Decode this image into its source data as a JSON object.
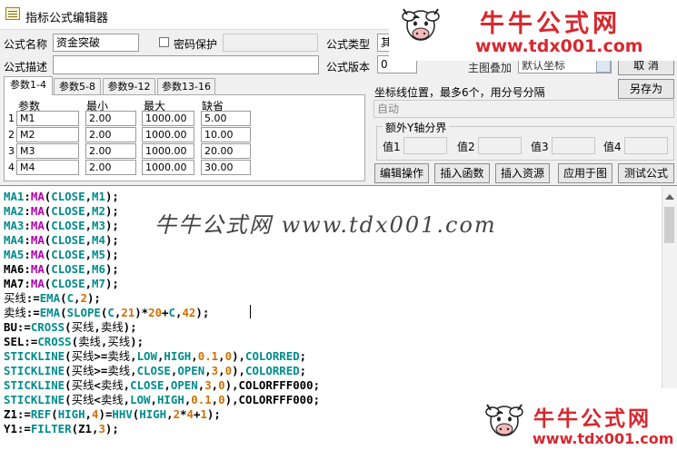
{
  "window": {
    "title": "指标公式编辑器"
  },
  "logo_top": {
    "title": "牛牛公式网",
    "url": "www.tdx001.com"
  },
  "logo_bottom": {
    "title": "牛牛公式网",
    "url": "www.tdx001.com"
  },
  "form": {
    "name_label": "公式名称",
    "name_value": "资金突破",
    "password_label": "密码保护",
    "type_label": "公式类型",
    "type_value": "其他",
    "desc_label": "公式描述",
    "desc_value": "",
    "version_label": "公式版本",
    "version_value": "0",
    "display_partial": "主图叠加",
    "axis_partial": "默认坐标",
    "cancel_partial": "取 消",
    "save_as_label": "另存为"
  },
  "tabs": [
    {
      "label": "参数1-4"
    },
    {
      "label": "参数5-8"
    },
    {
      "label": "参数9-12"
    },
    {
      "label": "参数13-16"
    }
  ],
  "params": {
    "headers": {
      "name": "参数",
      "min": "最小",
      "max": "最大",
      "default": "缺省"
    },
    "rows": [
      {
        "num": "1",
        "name": "M1",
        "min": "2.00",
        "max": "1000.00",
        "default": "5.00"
      },
      {
        "num": "2",
        "name": "M2",
        "min": "2.00",
        "max": "1000.00",
        "default": "10.00"
      },
      {
        "num": "3",
        "name": "M3",
        "min": "2.00",
        "max": "1000.00",
        "default": "20.00"
      },
      {
        "num": "4",
        "name": "M4",
        "min": "2.00",
        "max": "1000.00",
        "default": "30.00"
      }
    ]
  },
  "axis": {
    "label": "坐标线位置，最多6个，用分号分隔",
    "value": "自动"
  },
  "extra_y": {
    "title": "额外Y轴分界",
    "values": [
      {
        "label": "值1",
        "value": ""
      },
      {
        "label": "值2",
        "value": ""
      },
      {
        "label": "值3",
        "value": ""
      },
      {
        "label": "值4",
        "value": ""
      }
    ]
  },
  "buttons": {
    "edit": "编辑操作",
    "insert_func": "插入函数",
    "insert_res": "插入资源",
    "apply": "应用于图",
    "test": "测试公式"
  },
  "editor": {
    "watermark": "牛牛公式网 www.tdx001.com",
    "lines": [
      [
        [
          "kw",
          "MA1"
        ],
        [
          "op",
          ":"
        ],
        [
          "fn",
          "MA"
        ],
        [
          "op",
          "("
        ],
        [
          "kw",
          "CLOSE"
        ],
        [
          "op",
          ","
        ],
        [
          "kw",
          "M1"
        ],
        [
          "op",
          ");"
        ]
      ],
      [
        [
          "kw",
          "MA2"
        ],
        [
          "op",
          ":"
        ],
        [
          "fn",
          "MA"
        ],
        [
          "op",
          "("
        ],
        [
          "kw",
          "CLOSE"
        ],
        [
          "op",
          ","
        ],
        [
          "kw",
          "M2"
        ],
        [
          "op",
          ");"
        ]
      ],
      [
        [
          "kw",
          "MA3"
        ],
        [
          "op",
          ":"
        ],
        [
          "fn",
          "MA"
        ],
        [
          "op",
          "("
        ],
        [
          "kw",
          "CLOSE"
        ],
        [
          "op",
          ","
        ],
        [
          "kw",
          "M3"
        ],
        [
          "op",
          ");"
        ]
      ],
      [
        [
          "kw",
          "MA4"
        ],
        [
          "op",
          ":"
        ],
        [
          "fn",
          "MA"
        ],
        [
          "op",
          "("
        ],
        [
          "kw",
          "CLOSE"
        ],
        [
          "op",
          ","
        ],
        [
          "kw",
          "M4"
        ],
        [
          "op",
          ");"
        ]
      ],
      [
        [
          "kw",
          "MA5"
        ],
        [
          "op",
          ":"
        ],
        [
          "fn",
          "MA"
        ],
        [
          "op",
          "("
        ],
        [
          "kw",
          "CLOSE"
        ],
        [
          "op",
          ","
        ],
        [
          "kw",
          "M5"
        ],
        [
          "op",
          ");"
        ]
      ],
      [
        [
          "op",
          "MA6"
        ],
        [
          "op",
          ":"
        ],
        [
          "fn",
          "MA"
        ],
        [
          "op",
          "("
        ],
        [
          "kw",
          "CLOSE"
        ],
        [
          "op",
          ","
        ],
        [
          "kw",
          "M6"
        ],
        [
          "op",
          ");"
        ]
      ],
      [
        [
          "op",
          "MA7"
        ],
        [
          "op",
          ":"
        ],
        [
          "fn",
          "MA"
        ],
        [
          "op",
          "("
        ],
        [
          "kw",
          "CLOSE"
        ],
        [
          "op",
          ","
        ],
        [
          "kw",
          "M7"
        ],
        [
          "op",
          ");"
        ]
      ],
      [
        [
          "tx",
          "买线"
        ],
        [
          "op",
          ":="
        ],
        [
          "kw",
          "EMA"
        ],
        [
          "op",
          "("
        ],
        [
          "kw",
          "C"
        ],
        [
          "op",
          ","
        ],
        [
          "num",
          "2"
        ],
        [
          "op",
          ");"
        ]
      ],
      [
        [
          "tx",
          "卖线"
        ],
        [
          "op",
          ":="
        ],
        [
          "kw",
          "EMA"
        ],
        [
          "op",
          "("
        ],
        [
          "kw",
          "SLOPE"
        ],
        [
          "op",
          "("
        ],
        [
          "kw",
          "C"
        ],
        [
          "op",
          ","
        ],
        [
          "num",
          "21"
        ],
        [
          "op",
          ")*"
        ],
        [
          "num",
          "20"
        ],
        [
          "op",
          "+"
        ],
        [
          "kw",
          "C"
        ],
        [
          "op",
          ","
        ],
        [
          "num",
          "42"
        ],
        [
          "op",
          ");"
        ]
      ],
      [
        [
          "op",
          "BU:="
        ],
        [
          "kw",
          "CROSS"
        ],
        [
          "op",
          "("
        ],
        [
          "tx",
          "买线"
        ],
        [
          "op",
          ","
        ],
        [
          "tx",
          "卖线"
        ],
        [
          "op",
          ");"
        ]
      ],
      [
        [
          "op",
          "SEL:="
        ],
        [
          "kw",
          "CROSS"
        ],
        [
          "op",
          "("
        ],
        [
          "tx",
          "卖线"
        ],
        [
          "op",
          ","
        ],
        [
          "tx",
          "买线"
        ],
        [
          "op",
          ");"
        ]
      ],
      [
        [
          "kw",
          "STICKLINE"
        ],
        [
          "op",
          "("
        ],
        [
          "tx",
          "买线"
        ],
        [
          "op",
          ">="
        ],
        [
          "tx",
          "卖线"
        ],
        [
          "op",
          ","
        ],
        [
          "kw",
          "LOW"
        ],
        [
          "op",
          ","
        ],
        [
          "kw",
          "HIGH"
        ],
        [
          "op",
          ","
        ],
        [
          "num",
          "0.1"
        ],
        [
          "op",
          ","
        ],
        [
          "num",
          "0"
        ],
        [
          "op",
          "),"
        ],
        [
          "kw",
          "COLORRED"
        ],
        [
          "op",
          ";"
        ]
      ],
      [
        [
          "kw",
          "STICKLINE"
        ],
        [
          "op",
          "("
        ],
        [
          "tx",
          "买线"
        ],
        [
          "op",
          ">="
        ],
        [
          "tx",
          "卖线"
        ],
        [
          "op",
          ","
        ],
        [
          "kw",
          "CLOSE"
        ],
        [
          "op",
          ","
        ],
        [
          "kw",
          "OPEN"
        ],
        [
          "op",
          ","
        ],
        [
          "num",
          "3"
        ],
        [
          "op",
          ","
        ],
        [
          "num",
          "0"
        ],
        [
          "op",
          "),"
        ],
        [
          "kw",
          "COLORRED"
        ],
        [
          "op",
          ";"
        ]
      ],
      [
        [
          "kw",
          "STICKLINE"
        ],
        [
          "op",
          "("
        ],
        [
          "tx",
          "买线"
        ],
        [
          "op",
          "<"
        ],
        [
          "tx",
          "卖线"
        ],
        [
          "op",
          ","
        ],
        [
          "kw",
          "CLOSE"
        ],
        [
          "op",
          ","
        ],
        [
          "kw",
          "OPEN"
        ],
        [
          "op",
          ","
        ],
        [
          "num",
          "3"
        ],
        [
          "op",
          ","
        ],
        [
          "num",
          "0"
        ],
        [
          "op",
          "),"
        ],
        [
          "col",
          "COLORFFF000"
        ],
        [
          "op",
          ";"
        ]
      ],
      [
        [
          "kw",
          "STICKLINE"
        ],
        [
          "op",
          "("
        ],
        [
          "tx",
          "买线"
        ],
        [
          "op",
          "<"
        ],
        [
          "tx",
          "卖线"
        ],
        [
          "op",
          ","
        ],
        [
          "kw",
          "LOW"
        ],
        [
          "op",
          ","
        ],
        [
          "kw",
          "HIGH"
        ],
        [
          "op",
          ","
        ],
        [
          "num",
          "0.1"
        ],
        [
          "op",
          ","
        ],
        [
          "num",
          "0"
        ],
        [
          "op",
          "),"
        ],
        [
          "col",
          "COLORFFF000"
        ],
        [
          "op",
          ";"
        ]
      ],
      [
        [
          "op",
          "Z1:="
        ],
        [
          "kw",
          "REF"
        ],
        [
          "op",
          "("
        ],
        [
          "kw",
          "HIGH"
        ],
        [
          "op",
          ","
        ],
        [
          "num",
          "4"
        ],
        [
          "op",
          ")="
        ],
        [
          "kw",
          "HHV"
        ],
        [
          "op",
          "("
        ],
        [
          "kw",
          "HIGH"
        ],
        [
          "op",
          ","
        ],
        [
          "num",
          "2"
        ],
        [
          "op",
          "*"
        ],
        [
          "num",
          "4"
        ],
        [
          "op",
          "+"
        ],
        [
          "num",
          "1"
        ],
        [
          "op",
          ");"
        ]
      ],
      [
        [
          "op",
          "Y1:="
        ],
        [
          "kw",
          "FILTER"
        ],
        [
          "op",
          "(Z1,"
        ],
        [
          "num",
          "3"
        ],
        [
          "op",
          ");"
        ]
      ]
    ]
  }
}
